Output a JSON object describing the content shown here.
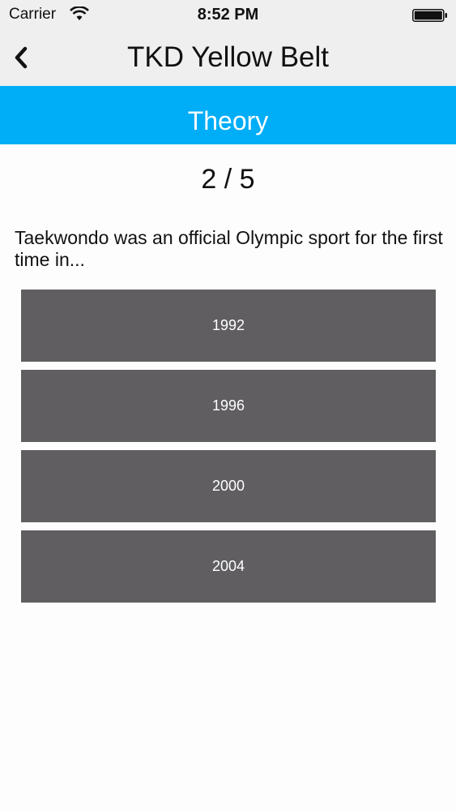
{
  "status_bar": {
    "carrier": "Carrier",
    "time": "8:52 PM",
    "icons": [
      "wifi-icon",
      "battery-icon"
    ]
  },
  "nav": {
    "title": "TKD Yellow Belt",
    "back_icon": "chevron-left-icon"
  },
  "section": {
    "title": "Theory",
    "color": "#00adf7"
  },
  "quiz": {
    "progress": "2 / 5",
    "question": "Taekwondo was an official Olympic sport for the first time in...",
    "answers": [
      "1992",
      "1996",
      "2000",
      "2004"
    ]
  },
  "colors": {
    "nav_background": "#efefef",
    "answer_button": "#605e61",
    "page_background": "#fdfdfd"
  }
}
